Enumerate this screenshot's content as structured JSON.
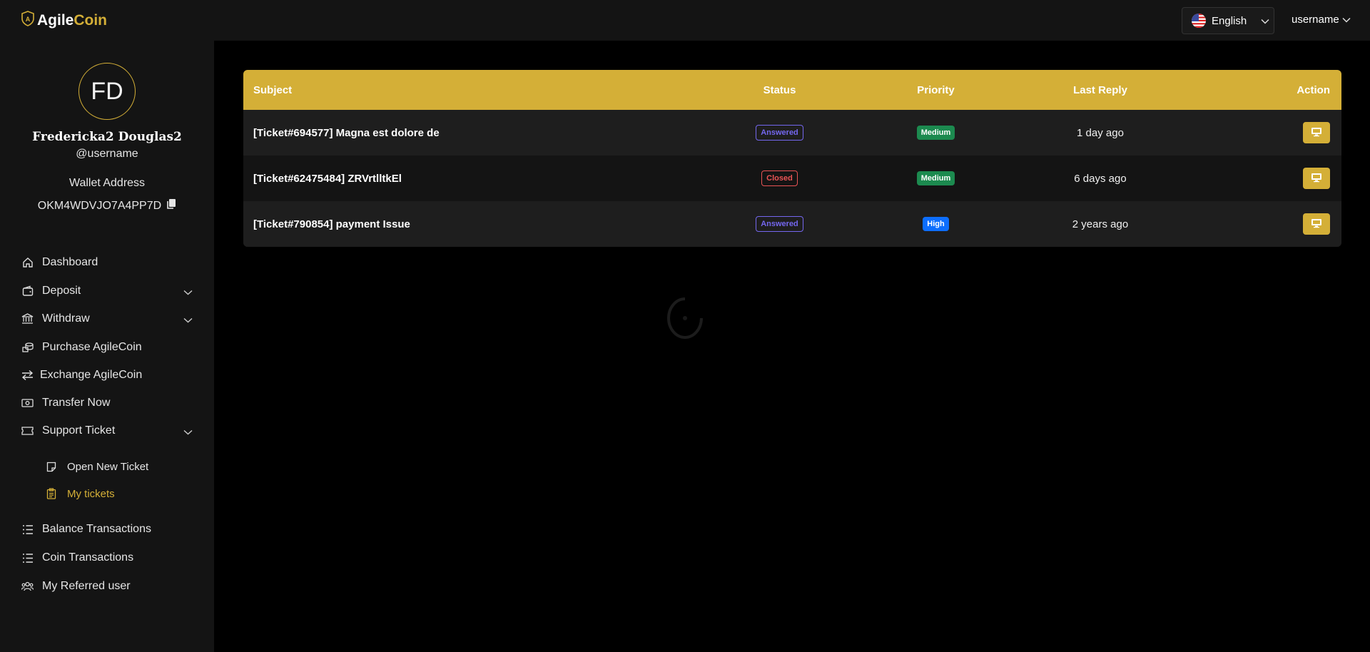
{
  "header": {
    "logo_part1": "Agile",
    "logo_part2": "Coin",
    "language": "English",
    "user_menu_label": "username"
  },
  "profile": {
    "initials": "FD",
    "full_name": "Fredericka2 Douglas2",
    "handle": "@username",
    "wallet_label": "Wallet Address",
    "wallet_address": "OKM4WDVJO7A4PP7D"
  },
  "sidebar": {
    "items": [
      {
        "label": "Dashboard",
        "icon": "home-icon"
      },
      {
        "label": "Deposit",
        "icon": "wallet-icon"
      },
      {
        "label": "Withdraw",
        "icon": "bank-icon"
      },
      {
        "label": "Purchase AgileCoin",
        "icon": "coins-icon"
      },
      {
        "label": "Exchange AgileCoin",
        "icon": "exchange-icon"
      },
      {
        "label": "Transfer Now",
        "icon": "money-icon"
      },
      {
        "label": "Support Ticket",
        "icon": "ticket-icon"
      },
      {
        "label": "Balance Transactions",
        "icon": "list-icon"
      },
      {
        "label": "Coin Transactions",
        "icon": "list-icon"
      },
      {
        "label": "My Referred user",
        "icon": "users-icon"
      }
    ],
    "support_sub": [
      {
        "label": "Open New Ticket",
        "icon": "note-icon"
      },
      {
        "label": "My tickets",
        "icon": "clipboard-icon"
      }
    ]
  },
  "table": {
    "headers": {
      "subject": "Subject",
      "status": "Status",
      "priority": "Priority",
      "last_reply": "Last Reply",
      "action": "Action"
    },
    "rows": [
      {
        "subject": "[Ticket#694577] Magna est dolore de",
        "status": "Answered",
        "priority": "Medium",
        "last_reply": "1 day ago"
      },
      {
        "subject": "[Ticket#62475484] ZRVrtlltkEl",
        "status": "Closed",
        "priority": "Medium",
        "last_reply": "6 days ago"
      },
      {
        "subject": "[Ticket#790854] payment Issue",
        "status": "Answered",
        "priority": "High",
        "last_reply": "2 years ago"
      }
    ]
  },
  "colors": {
    "accent": "#d4af37",
    "answered": "#7467ef",
    "closed": "#ea5455",
    "medium": "#1c8a4f",
    "high": "#0d6efd"
  }
}
